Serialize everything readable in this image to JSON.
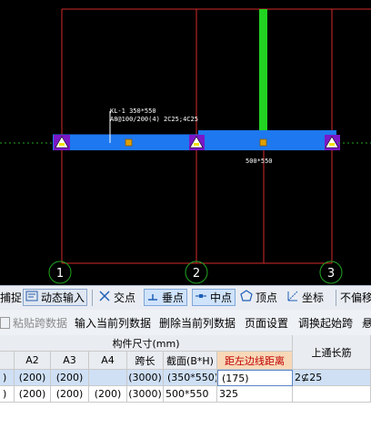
{
  "canvas": {
    "beam_label_line1": "KL-1 350*550",
    "beam_label_line2": "A8@100/200(4) 2C25;4C25",
    "section_label": "500*550",
    "axis_labels": [
      "1",
      "2",
      "3"
    ],
    "colors": {
      "background": "#000000",
      "grid_line": "#d42a2a",
      "beam": "#1e78f0",
      "column_green": "#22d322",
      "support": "#7a18c8",
      "axis_circle": "#22a522"
    }
  },
  "snap_bar": {
    "items": [
      {
        "label": "捕捉",
        "icon": "capture-icon",
        "active": false
      },
      {
        "label": "动态输入",
        "icon": "dynamic-input-icon",
        "active": false
      },
      {
        "label": "交点",
        "icon": "intersection-icon",
        "active": false
      },
      {
        "label": "垂点",
        "icon": "perpendicular-icon",
        "active": true
      },
      {
        "label": "中点",
        "icon": "midpoint-icon",
        "active": true
      },
      {
        "label": "顶点",
        "icon": "vertex-icon",
        "active": false
      },
      {
        "label": "坐标",
        "icon": "coordinate-icon",
        "active": false
      },
      {
        "label": "不偏移",
        "icon": "",
        "active": false
      }
    ]
  },
  "toolbar": {
    "items": [
      {
        "label": "粘贴跨数据",
        "icon": "paste-icon",
        "enabled": false
      },
      {
        "label": "输入当前列数据",
        "enabled": true
      },
      {
        "label": "删除当前列数据",
        "enabled": true
      },
      {
        "label": "页面设置",
        "enabled": true
      },
      {
        "label": "调换起始跨",
        "enabled": true
      },
      {
        "label": "悬",
        "enabled": true
      }
    ]
  },
  "table": {
    "group_header": "构件尺寸(mm)",
    "columns": [
      "A2",
      "A3",
      "A4",
      "跨长",
      "截面(B*H)",
      "距左边线距离",
      "上通长筋"
    ],
    "rows": [
      {
        "lead": ")",
        "cells": [
          "(200)",
          "(200)",
          "",
          "(3000)",
          "(350*550)",
          "(175)",
          "2⊈25"
        ],
        "selected": true
      },
      {
        "lead": ")",
        "cells": [
          "(200)",
          "(200)",
          "(200)",
          "(3000)",
          "500*550",
          "325",
          ""
        ],
        "selected": false
      }
    ],
    "highlight_header_color": "#f7d8b8"
  }
}
